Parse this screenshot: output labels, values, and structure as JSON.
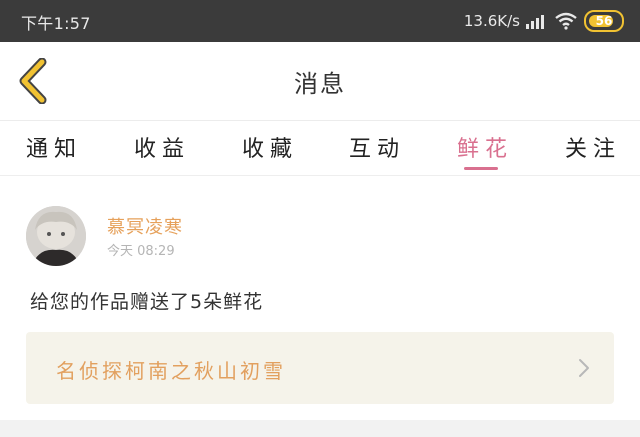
{
  "status_bar": {
    "time": "下午1:57",
    "network_speed": "13.6K/s",
    "battery": "56"
  },
  "header": {
    "title": "消息"
  },
  "tabs": [
    {
      "label": "通知"
    },
    {
      "label": "收益"
    },
    {
      "label": "收藏"
    },
    {
      "label": "互动"
    },
    {
      "label": "鲜花",
      "active": true
    },
    {
      "label": "关注"
    }
  ],
  "message": {
    "sender": "慕冥凌寒",
    "time": "今天 08:29",
    "text": "给您的作品赠送了5朵鲜花",
    "work_title": "名侦探柯南之秋山初雪"
  },
  "colors": {
    "accent": "#d9708f",
    "sender": "#e6a15b",
    "work_title": "#e2a05f",
    "back_icon": "#f1c232"
  }
}
